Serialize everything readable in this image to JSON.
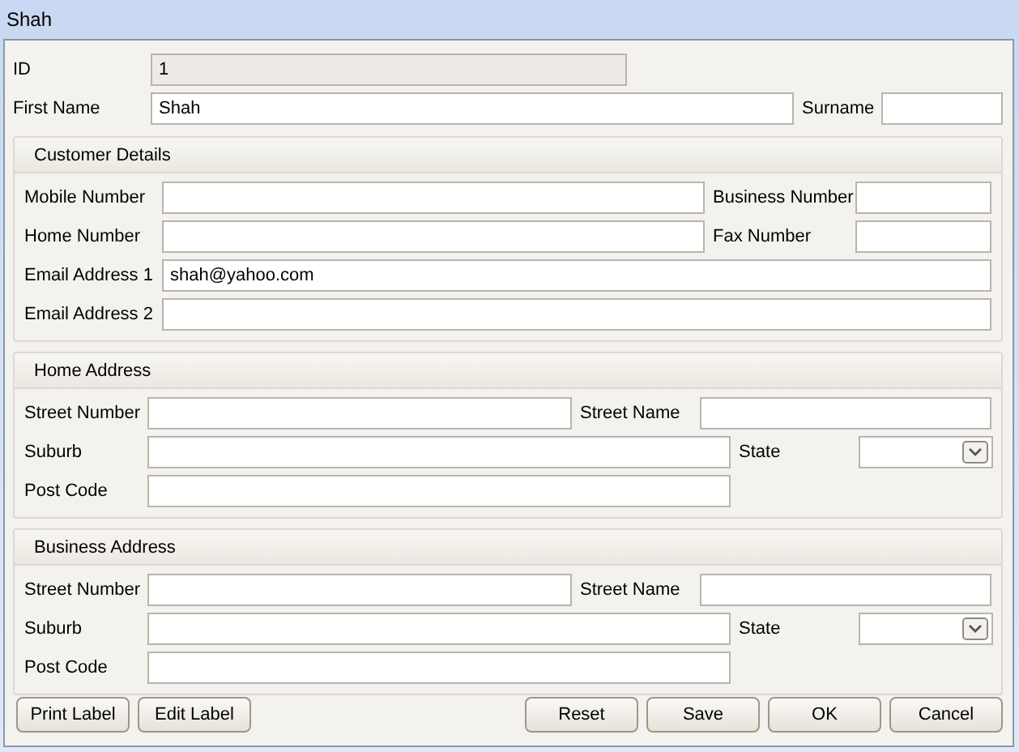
{
  "window": {
    "title": "Shah"
  },
  "top_fields": [
    {
      "label": "ID",
      "value": "1",
      "disabled": true
    },
    {
      "label": "First Name",
      "value": "Shah",
      "disabled": false
    },
    {
      "label": "Surname",
      "disabled": false
    }
  ],
  "sections": [
    {
      "title": "Customer Details",
      "kind": "contact",
      "rows": [
        [
          {
            "label": "Mobile Number",
            "kind": "text"
          },
          {
            "label": "Business Number",
            "kind": "text"
          }
        ],
        [
          {
            "label": "Home Number",
            "kind": "text"
          },
          {
            "label": "Fax Number",
            "kind": "text"
          }
        ],
        [
          {
            "label": "Email Address 1",
            "kind": "text",
            "value": "shah@yahoo.com"
          }
        ],
        [
          {
            "label": "Email Address 2",
            "kind": "text"
          }
        ]
      ]
    },
    {
      "title": "Home Address",
      "kind": "address",
      "rows": [
        [
          {
            "label": "Street Number",
            "kind": "text"
          },
          {
            "label": "Street Name",
            "kind": "text"
          }
        ],
        [
          {
            "label": "Suburb",
            "kind": "text"
          },
          {
            "label": "State",
            "kind": "select"
          }
        ],
        [
          {
            "label": "Post Code",
            "kind": "text"
          }
        ]
      ]
    },
    {
      "title": "Business Address",
      "kind": "address",
      "rows": [
        [
          {
            "label": "Street Number",
            "kind": "text"
          },
          {
            "label": "Street Name",
            "kind": "text"
          }
        ],
        [
          {
            "label": "Suburb",
            "kind": "text"
          },
          {
            "label": "State",
            "kind": "select"
          }
        ],
        [
          {
            "label": "Post Code",
            "kind": "text"
          }
        ]
      ]
    }
  ],
  "buttons_left": [
    "Print Label",
    "Edit Label"
  ],
  "buttons_right": [
    "Reset",
    "Save",
    "OK",
    "Cancel"
  ]
}
